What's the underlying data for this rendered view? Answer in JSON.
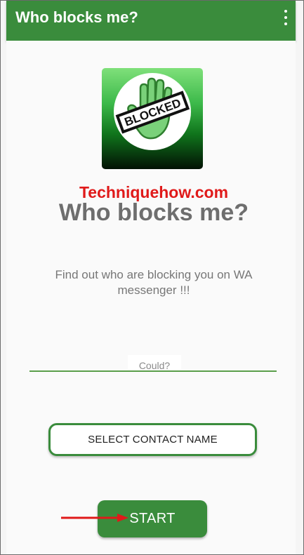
{
  "app_bar": {
    "title": "Who blocks me?",
    "menu_icon": "more-vert-icon",
    "background_color": "#3a8c3c"
  },
  "logo": {
    "badge_text": "BLOCKED",
    "icon": "blocked-hand-icon"
  },
  "main": {
    "heading": "Who blocks me?",
    "watermark": "Techniquehow.com",
    "description": "Find out who are blocking you on WA messenger !!!",
    "input_value": "Could?"
  },
  "buttons": {
    "select_contact": "SELECT CONTACT NAME",
    "start": "START",
    "accent_color": "#3a8c3c"
  },
  "annotation": {
    "arrow_color": "#e01a1a",
    "arrow_icon": "red-arrow-icon"
  }
}
